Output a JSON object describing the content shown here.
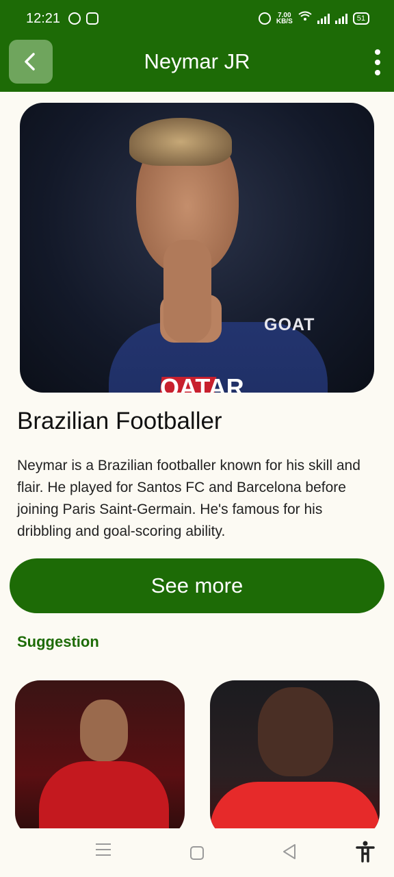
{
  "status_bar": {
    "time": "12:21",
    "speed_value": "7.00",
    "speed_unit": "KB/S",
    "battery": "51"
  },
  "app_bar": {
    "title": "Neymar JR",
    "back_icon": "chevron-left-icon",
    "menu_icon": "more-vertical-icon"
  },
  "hero": {
    "jersey_text_1": "GOAT",
    "jersey_text_2": "QATAR"
  },
  "main": {
    "section_title": "Brazilian Footballer",
    "description": "Neymar is a Brazilian footballer known for his skill and flair. He played for Santos FC and Barcelona before joining Paris Saint-Germain. He's famous for his dribbling and goal-scoring ability.",
    "see_more_label": "See more",
    "suggestion_label": "Suggestion"
  },
  "colors": {
    "primary": "#1d6b06",
    "background": "#fcfaf3",
    "back_button": "#6fa55d"
  },
  "nav": {
    "icons": [
      "menu-icon",
      "home-icon",
      "back-icon",
      "accessibility-icon"
    ]
  }
}
